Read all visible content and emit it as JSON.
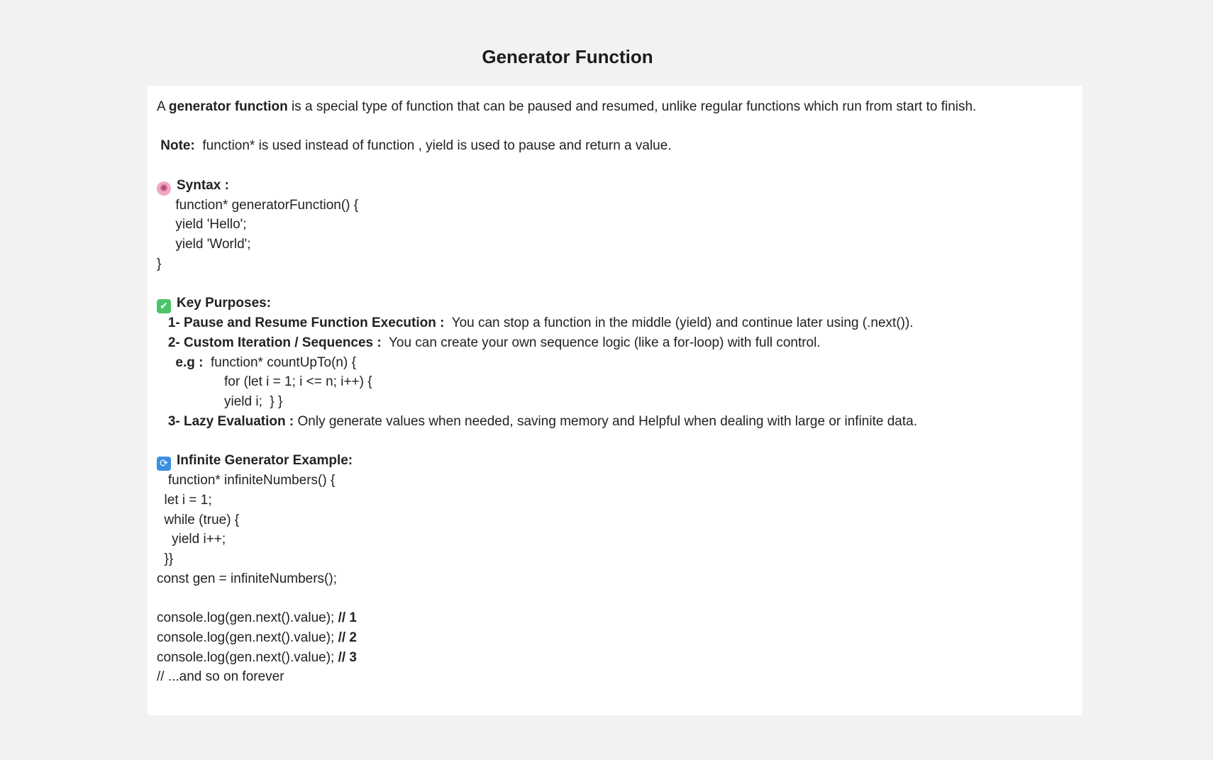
{
  "title": "Generator Function",
  "intro": {
    "prefix": "A ",
    "bold": "generator function",
    "suffix": " is a special type of function that can be paused and resumed, unlike regular functions which run from start to finish."
  },
  "note": {
    "label": " Note: ",
    "text": " function* is used instead of function , yield is used to pause and return a value."
  },
  "syntax": {
    "heading": "Syntax :",
    "lines": [
      "     function* generatorFunction() {",
      "     yield 'Hello';",
      "     yield 'World';",
      "}"
    ]
  },
  "purposes": {
    "heading": "Key Purposes:",
    "p1_label": "   1- Pause and Resume Function Execution : ",
    "p1_text": " You can stop a function in the middle (yield) and continue later using (.next()).",
    "p2_label": "   2- Custom Iteration / Sequences : ",
    "p2_text": " You can create your own sequence logic (like a for-loop) with full control.",
    "eg_label": "     e.g : ",
    "eg_text": " function* countUpTo(n) {",
    "eg_lines": [
      "                  for (let i = 1; i <= n; i++) {",
      "                  yield i;  } }"
    ],
    "p3_label": "   3- Lazy Evaluation : ",
    "p3_text": "Only generate values when needed, saving memory and Helpful when dealing with large or infinite data."
  },
  "example": {
    "heading": "Infinite Generator Example:",
    "lines": [
      "   function* infiniteNumbers() {",
      "  let i = 1;",
      "  while (true) {",
      "    yield i++;",
      "  }}",
      "const gen = infiniteNumbers();"
    ],
    "logs": [
      {
        "code": "console.log(gen.next().value); ",
        "comment": "// 1"
      },
      {
        "code": "console.log(gen.next().value); ",
        "comment": "// 2"
      },
      {
        "code": "console.log(gen.next().value); ",
        "comment": "// 3"
      }
    ],
    "footer": "// ...and so on forever"
  },
  "icons": {
    "syntax": "brain-icon",
    "purposes": "check-mark-icon",
    "example": "refresh-icon"
  }
}
